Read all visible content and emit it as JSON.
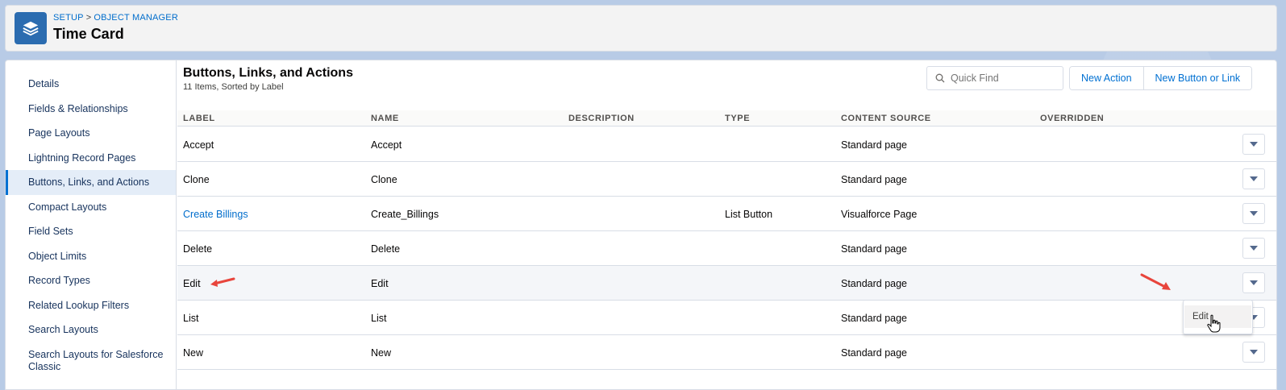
{
  "header": {
    "breadcrumb": [
      "SETUP",
      "OBJECT MANAGER"
    ],
    "breadcrumb_sep": ">",
    "title": "Time Card",
    "icon": "layers-icon"
  },
  "sidebar": {
    "items": [
      {
        "label": "Details"
      },
      {
        "label": "Fields & Relationships"
      },
      {
        "label": "Page Layouts"
      },
      {
        "label": "Lightning Record Pages"
      },
      {
        "label": "Buttons, Links, and Actions",
        "active": true
      },
      {
        "label": "Compact Layouts"
      },
      {
        "label": "Field Sets"
      },
      {
        "label": "Object Limits"
      },
      {
        "label": "Record Types"
      },
      {
        "label": "Related Lookup Filters"
      },
      {
        "label": "Search Layouts"
      },
      {
        "label": "Search Layouts for Salesforce Classic"
      }
    ]
  },
  "section": {
    "title": "Buttons, Links, and Actions",
    "subtitle": "11 Items, Sorted by Label"
  },
  "search": {
    "placeholder": "Quick Find",
    "icon": "search-icon"
  },
  "actions": {
    "new_action": "New Action",
    "new_button_or_link": "New Button or Link"
  },
  "table": {
    "columns": [
      "LABEL",
      "NAME",
      "DESCRIPTION",
      "TYPE",
      "CONTENT SOURCE",
      "OVERRIDDEN"
    ],
    "rows": [
      {
        "label": "Accept",
        "name": "Accept",
        "description": "",
        "type": "",
        "content_source": "Standard page",
        "overridden": ""
      },
      {
        "label": "Clone",
        "name": "Clone",
        "description": "",
        "type": "",
        "content_source": "Standard page",
        "overridden": ""
      },
      {
        "label": "Create Billings",
        "name": "Create_Billings",
        "description": "",
        "type": "List Button",
        "content_source": "Visualforce Page",
        "overridden": "",
        "link": true
      },
      {
        "label": "Delete",
        "name": "Delete",
        "description": "",
        "type": "",
        "content_source": "Standard page",
        "overridden": ""
      },
      {
        "label": "Edit",
        "name": "Edit",
        "description": "",
        "type": "",
        "content_source": "Standard page",
        "overridden": "",
        "hover": true
      },
      {
        "label": "List",
        "name": "List",
        "description": "",
        "type": "",
        "content_source": "Standard page",
        "overridden": ""
      },
      {
        "label": "New",
        "name": "New",
        "description": "",
        "type": "",
        "content_source": "Standard page",
        "overridden": ""
      }
    ]
  },
  "row_menu": {
    "items": [
      "Edit"
    ]
  },
  "colors": {
    "accent": "#0070d2",
    "annotation_arrow": "#e8453c"
  }
}
